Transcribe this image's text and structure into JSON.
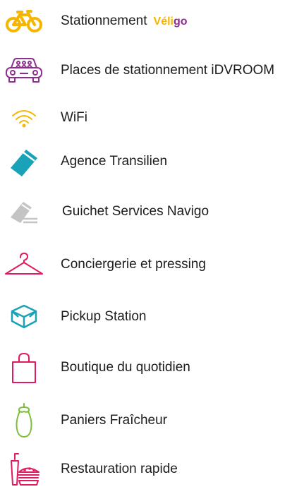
{
  "services": [
    {
      "label": "Stationnement",
      "brand_part1": "Véli",
      "brand_part2": "go",
      "icon": "bicycle-icon",
      "color": "#f5b500"
    },
    {
      "label": "Places de stationnement iDVROOM",
      "icon": "carpool-car-icon",
      "color": "#8d2f8e"
    },
    {
      "label": "WiFi",
      "icon": "wifi-icon",
      "color": "#f5b500"
    },
    {
      "label": "Agence Transilien",
      "icon": "ticket-card-icon",
      "color": "#1aa3b8"
    },
    {
      "label": "Guichet Services Navigo",
      "icon": "navigo-pass-icon",
      "color": "#c4c4c4"
    },
    {
      "label": "Conciergerie et pressing",
      "icon": "clothes-hanger-icon",
      "color": "#e2195c"
    },
    {
      "label": "Pickup Station",
      "icon": "parcel-box-icon",
      "color": "#1aa3b8"
    },
    {
      "label": "Boutique du quotidien",
      "icon": "shopping-bag-icon",
      "color": "#e2195c"
    },
    {
      "label": "Paniers Fraîcheur",
      "icon": "eggplant-icon",
      "color": "#7dbf3b"
    },
    {
      "label": "Restauration rapide",
      "icon": "fast-food-icon",
      "color": "#e2195c"
    }
  ]
}
